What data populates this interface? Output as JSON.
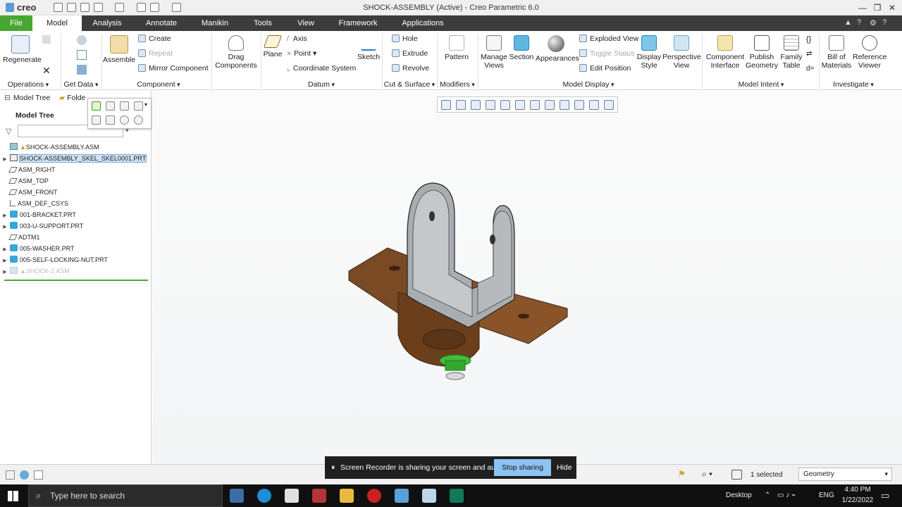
{
  "app": {
    "logo": "creo",
    "title": "SHOCK-ASSEMBLY (Active) - Creo Parametric 6.0"
  },
  "window_controls": {
    "minimize": "—",
    "restore": "❐",
    "close": "✕"
  },
  "tabs": [
    "File",
    "Model",
    "Analysis",
    "Annotate",
    "Manikin",
    "Tools",
    "View",
    "Framework",
    "Applications"
  ],
  "active_tab": "Model",
  "ribbon": {
    "operations": {
      "regenerate": "Regenerate",
      "label": "Operations"
    },
    "get_data": {
      "label": "Get Data"
    },
    "component": {
      "assemble": "Assemble",
      "create": "Create",
      "repeat": "Repeat",
      "mirror": "Mirror Component",
      "label": "Component"
    },
    "drag": {
      "label": "Drag Components"
    },
    "datum": {
      "plane": "Plane",
      "axis": "Axis",
      "point": "Point",
      "csys": "Coordinate System",
      "sketch": "Sketch",
      "label": "Datum"
    },
    "cut_surface": {
      "hole": "Hole",
      "extrude": "Extrude",
      "revolve": "Revolve",
      "label": "Cut & Surface"
    },
    "modifiers": {
      "pattern": "Pattern",
      "label": "Modifiers"
    },
    "model_display": {
      "manage_views": "Manage Views",
      "section": "Section",
      "appearances": "Appearances",
      "exploded": "Exploded View",
      "toggle_status": "Toggle Status",
      "edit_position": "Edit Position",
      "display_style": "Display Style",
      "perspective": "Perspective View",
      "label": "Model Display"
    },
    "model_intent": {
      "component_interface": "Component Interface",
      "publish_geometry": "Publish Geometry",
      "family_table": "Family Table",
      "label": "Model Intent"
    },
    "investigate": {
      "bom": "Bill of Materials",
      "reference_viewer": "Reference Viewer",
      "label": "Investigate"
    }
  },
  "panel": {
    "tab_model_tree": "Model Tree",
    "tab_folder": "Folde",
    "header": "Model Tree",
    "items": [
      {
        "label": "SHOCK-ASSEMBLY.ASM"
      },
      {
        "label": "SHOCK-ASSEMBLY_SKEL_SKEL0001.PRT"
      },
      {
        "label": "ASM_RIGHT"
      },
      {
        "label": "ASM_TOP"
      },
      {
        "label": "ASM_FRONT"
      },
      {
        "label": "ASM_DEF_CSYS"
      },
      {
        "label": "001-BRACKET.PRT"
      },
      {
        "label": "003-U-SUPPORT.PRT"
      },
      {
        "label": "ADTM1"
      },
      {
        "label": "005-WASHER.PRT"
      },
      {
        "label": "005-SELF-LOCKING-NUT.PRT"
      },
      {
        "label": "SHOCK-2.ASM"
      }
    ]
  },
  "status": {
    "selected": "1 selected",
    "filter": "Geometry"
  },
  "share": {
    "message": "Screen Recorder is sharing your screen and audio.",
    "stop": "Stop sharing",
    "hide": "Hide"
  },
  "taskbar": {
    "search_placeholder": "Type here to search",
    "desktop": "Desktop",
    "lang": "ENG",
    "time": "4:40 PM",
    "date": "1/22/2022"
  },
  "colors": {
    "file_tab": "#4aa632",
    "tab_strip": "#3c3c3c",
    "bracket": "#7a4a25",
    "support": "#b8bcbf",
    "nut": "#3fbf3a"
  }
}
